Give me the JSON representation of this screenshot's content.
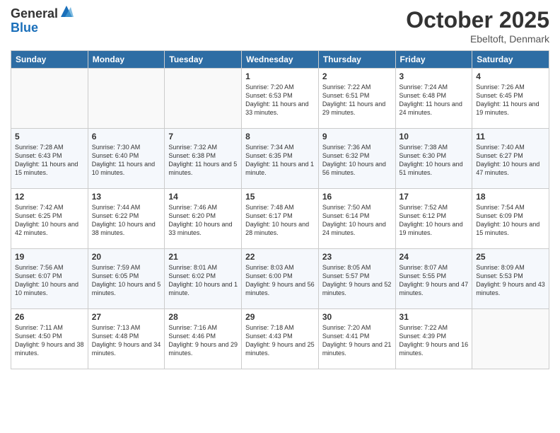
{
  "header": {
    "logo_general": "General",
    "logo_blue": "Blue",
    "month": "October 2025",
    "location": "Ebeltoft, Denmark"
  },
  "days_of_week": [
    "Sunday",
    "Monday",
    "Tuesday",
    "Wednesday",
    "Thursday",
    "Friday",
    "Saturday"
  ],
  "weeks": [
    [
      {
        "day": "",
        "info": ""
      },
      {
        "day": "",
        "info": ""
      },
      {
        "day": "",
        "info": ""
      },
      {
        "day": "1",
        "info": "Sunrise: 7:20 AM\nSunset: 6:53 PM\nDaylight: 11 hours\nand 33 minutes."
      },
      {
        "day": "2",
        "info": "Sunrise: 7:22 AM\nSunset: 6:51 PM\nDaylight: 11 hours\nand 29 minutes."
      },
      {
        "day": "3",
        "info": "Sunrise: 7:24 AM\nSunset: 6:48 PM\nDaylight: 11 hours\nand 24 minutes."
      },
      {
        "day": "4",
        "info": "Sunrise: 7:26 AM\nSunset: 6:45 PM\nDaylight: 11 hours\nand 19 minutes."
      }
    ],
    [
      {
        "day": "5",
        "info": "Sunrise: 7:28 AM\nSunset: 6:43 PM\nDaylight: 11 hours\nand 15 minutes."
      },
      {
        "day": "6",
        "info": "Sunrise: 7:30 AM\nSunset: 6:40 PM\nDaylight: 11 hours\nand 10 minutes."
      },
      {
        "day": "7",
        "info": "Sunrise: 7:32 AM\nSunset: 6:38 PM\nDaylight: 11 hours\nand 5 minutes."
      },
      {
        "day": "8",
        "info": "Sunrise: 7:34 AM\nSunset: 6:35 PM\nDaylight: 11 hours\nand 1 minute."
      },
      {
        "day": "9",
        "info": "Sunrise: 7:36 AM\nSunset: 6:32 PM\nDaylight: 10 hours\nand 56 minutes."
      },
      {
        "day": "10",
        "info": "Sunrise: 7:38 AM\nSunset: 6:30 PM\nDaylight: 10 hours\nand 51 minutes."
      },
      {
        "day": "11",
        "info": "Sunrise: 7:40 AM\nSunset: 6:27 PM\nDaylight: 10 hours\nand 47 minutes."
      }
    ],
    [
      {
        "day": "12",
        "info": "Sunrise: 7:42 AM\nSunset: 6:25 PM\nDaylight: 10 hours\nand 42 minutes."
      },
      {
        "day": "13",
        "info": "Sunrise: 7:44 AM\nSunset: 6:22 PM\nDaylight: 10 hours\nand 38 minutes."
      },
      {
        "day": "14",
        "info": "Sunrise: 7:46 AM\nSunset: 6:20 PM\nDaylight: 10 hours\nand 33 minutes."
      },
      {
        "day": "15",
        "info": "Sunrise: 7:48 AM\nSunset: 6:17 PM\nDaylight: 10 hours\nand 28 minutes."
      },
      {
        "day": "16",
        "info": "Sunrise: 7:50 AM\nSunset: 6:14 PM\nDaylight: 10 hours\nand 24 minutes."
      },
      {
        "day": "17",
        "info": "Sunrise: 7:52 AM\nSunset: 6:12 PM\nDaylight: 10 hours\nand 19 minutes."
      },
      {
        "day": "18",
        "info": "Sunrise: 7:54 AM\nSunset: 6:09 PM\nDaylight: 10 hours\nand 15 minutes."
      }
    ],
    [
      {
        "day": "19",
        "info": "Sunrise: 7:56 AM\nSunset: 6:07 PM\nDaylight: 10 hours\nand 10 minutes."
      },
      {
        "day": "20",
        "info": "Sunrise: 7:59 AM\nSunset: 6:05 PM\nDaylight: 10 hours\nand 5 minutes."
      },
      {
        "day": "21",
        "info": "Sunrise: 8:01 AM\nSunset: 6:02 PM\nDaylight: 10 hours\nand 1 minute."
      },
      {
        "day": "22",
        "info": "Sunrise: 8:03 AM\nSunset: 6:00 PM\nDaylight: 9 hours\nand 56 minutes."
      },
      {
        "day": "23",
        "info": "Sunrise: 8:05 AM\nSunset: 5:57 PM\nDaylight: 9 hours\nand 52 minutes."
      },
      {
        "day": "24",
        "info": "Sunrise: 8:07 AM\nSunset: 5:55 PM\nDaylight: 9 hours\nand 47 minutes."
      },
      {
        "day": "25",
        "info": "Sunrise: 8:09 AM\nSunset: 5:53 PM\nDaylight: 9 hours\nand 43 minutes."
      }
    ],
    [
      {
        "day": "26",
        "info": "Sunrise: 7:11 AM\nSunset: 4:50 PM\nDaylight: 9 hours\nand 38 minutes."
      },
      {
        "day": "27",
        "info": "Sunrise: 7:13 AM\nSunset: 4:48 PM\nDaylight: 9 hours\nand 34 minutes."
      },
      {
        "day": "28",
        "info": "Sunrise: 7:16 AM\nSunset: 4:46 PM\nDaylight: 9 hours\nand 29 minutes."
      },
      {
        "day": "29",
        "info": "Sunrise: 7:18 AM\nSunset: 4:43 PM\nDaylight: 9 hours\nand 25 minutes."
      },
      {
        "day": "30",
        "info": "Sunrise: 7:20 AM\nSunset: 4:41 PM\nDaylight: 9 hours\nand 21 minutes."
      },
      {
        "day": "31",
        "info": "Sunrise: 7:22 AM\nSunset: 4:39 PM\nDaylight: 9 hours\nand 16 minutes."
      },
      {
        "day": "",
        "info": ""
      }
    ]
  ]
}
